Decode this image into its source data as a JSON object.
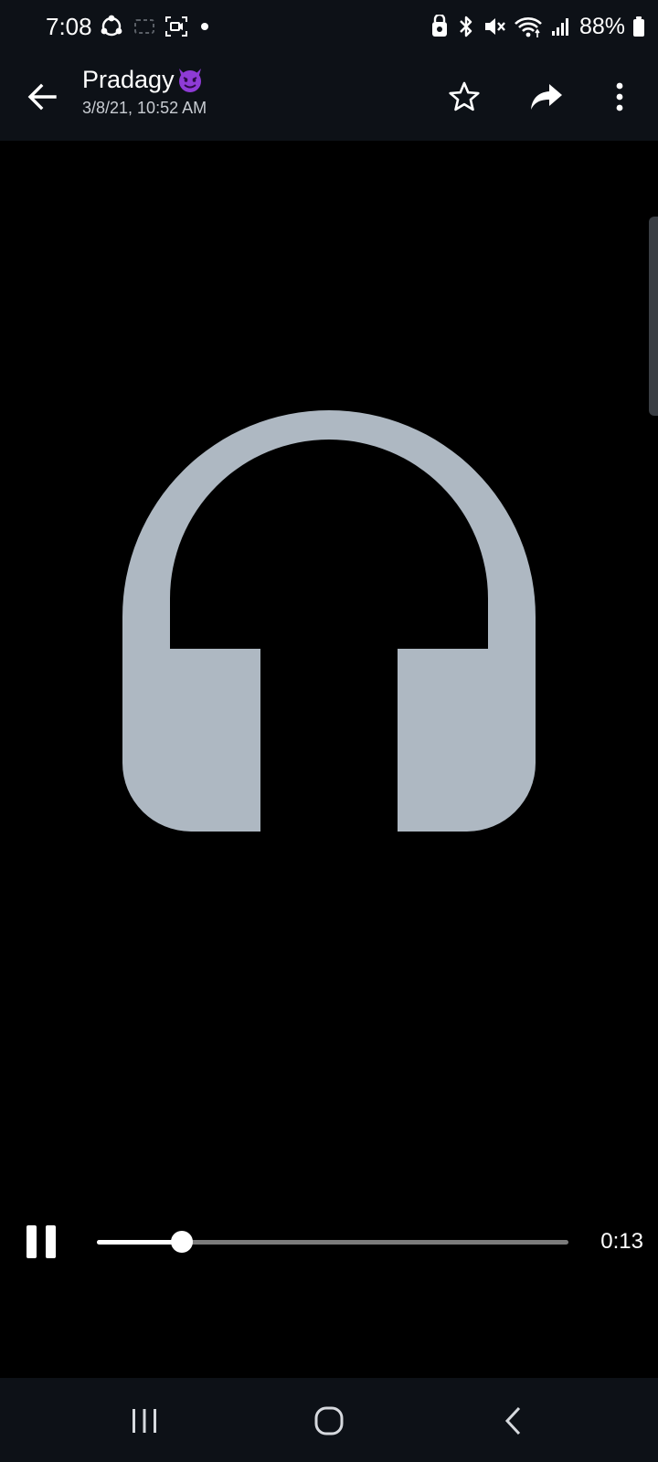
{
  "status_bar": {
    "time": "7:08",
    "battery_percent": "88%",
    "left_icons": [
      "sync-icon",
      "screen-record-icon",
      "screen-capture-icon",
      "notification-dot-icon"
    ],
    "right_icons": [
      "security-icon",
      "bluetooth-icon",
      "mute-icon",
      "wifi-icon",
      "signal-icon",
      "battery-icon"
    ]
  },
  "app_bar": {
    "contact_name": "Pradagy",
    "contact_emoji_icon": "smiling-devil-emoji-icon",
    "date": "3/8/21, 10:52 AM",
    "actions": [
      "star-icon",
      "share-icon",
      "more-icon"
    ]
  },
  "media": {
    "artwork_icon": "headphones-icon",
    "artwork_color": "#aeb8c2"
  },
  "player": {
    "state": "playing",
    "elapsed": "0:13",
    "progress": 0.18
  },
  "nav_bar": {
    "buttons": [
      "recents-icon",
      "home-icon",
      "back-icon"
    ]
  },
  "colors": {
    "bar_background": "#0d1117",
    "background": "#000000",
    "emoji": "#8e3bd6"
  }
}
